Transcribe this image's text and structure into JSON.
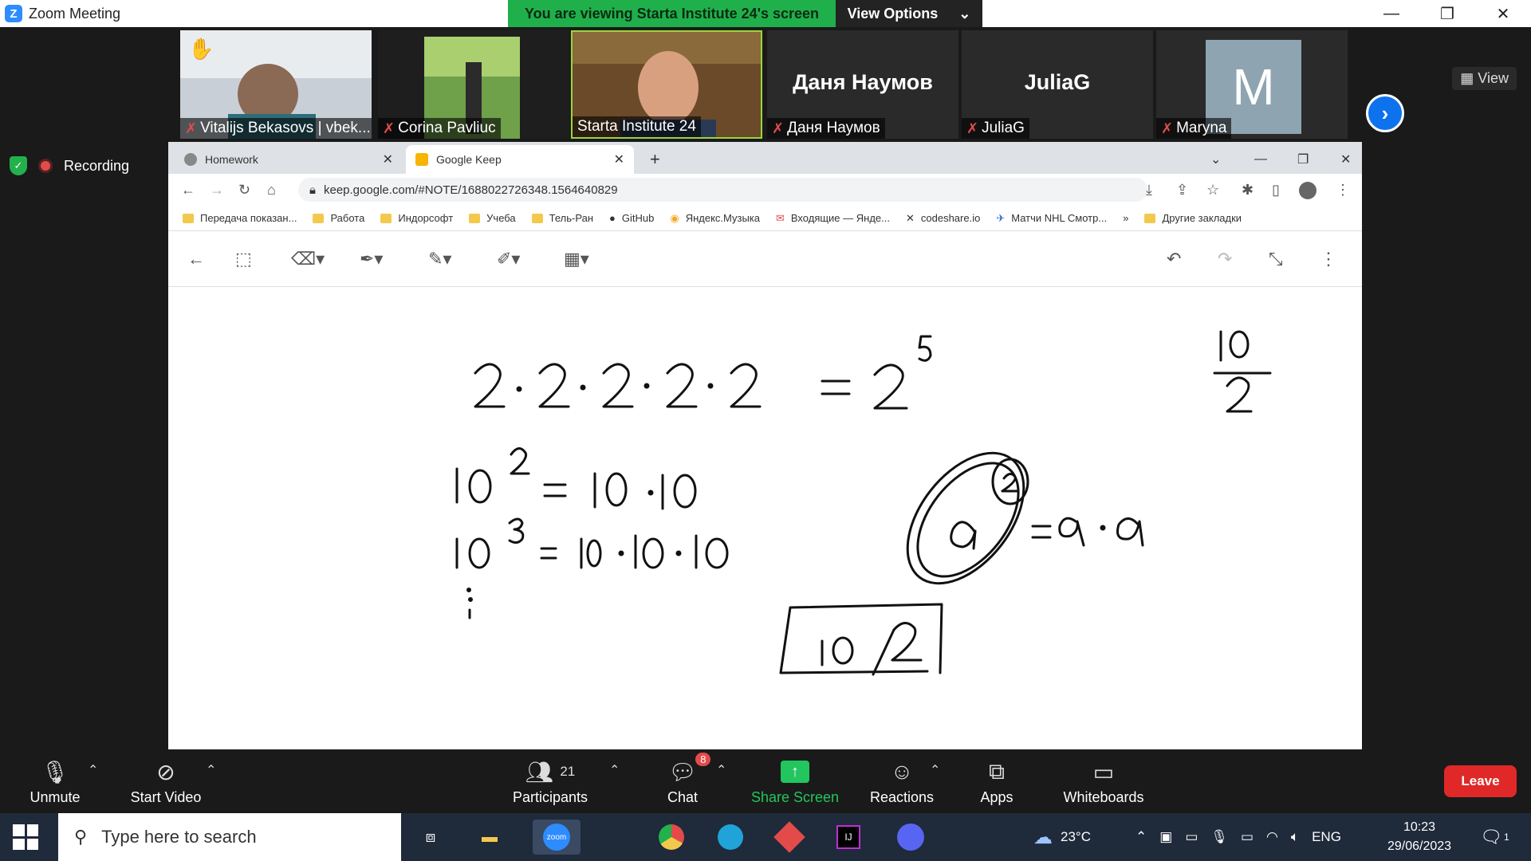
{
  "zoom": {
    "window_title": "Zoom Meeting",
    "banner": "You are viewing Starta Institute 24's screen",
    "view_options": "View Options",
    "view": "View",
    "recording": "Recording"
  },
  "participants": [
    {
      "name": "Vitalijs Bekasovs | vbek...",
      "big_name": ""
    },
    {
      "name": "Corina Pavliuc",
      "big_name": ""
    },
    {
      "name": "Starta Institute 24",
      "big_name": ""
    },
    {
      "name": "Даня Наумов",
      "big_name": "Даня Наумов"
    },
    {
      "name": "JuliaG",
      "big_name": "JuliaG"
    },
    {
      "name": "Maryna",
      "big_name": "M"
    }
  ],
  "browser": {
    "tabs": [
      {
        "label": "Homework"
      },
      {
        "label": "Google Keep"
      }
    ],
    "url": "keep.google.com/#NOTE/1688022726348.1564640829",
    "bookmarks": [
      "Передача показан...",
      "Работа",
      "Индорсофт",
      "Учеба",
      "Тель-Ран",
      "GitHub",
      "Яндекс.Музыка",
      "Входящие — Янде...",
      "codeshare.io",
      "Матчи NHL Смотр...",
      "»",
      "Другие закладки"
    ]
  },
  "controls": {
    "unmute": "Unmute",
    "start_video": "Start Video",
    "participants": "Participants",
    "participants_count": "21",
    "chat": "Chat",
    "chat_badge": "8",
    "share_screen": "Share Screen",
    "reactions": "Reactions",
    "apps": "Apps",
    "whiteboards": "Whiteboards",
    "leave": "Leave"
  },
  "taskbar": {
    "search_placeholder": "Type here to search",
    "temperature": "23°C",
    "language": "ENG",
    "time": "10:23",
    "date": "29/06/2023",
    "notifications": "1"
  },
  "colors": {
    "banner_green": "#20b04b",
    "leave_red": "#e02828",
    "share_green": "#22c55e",
    "active_border": "#9bd53b"
  }
}
